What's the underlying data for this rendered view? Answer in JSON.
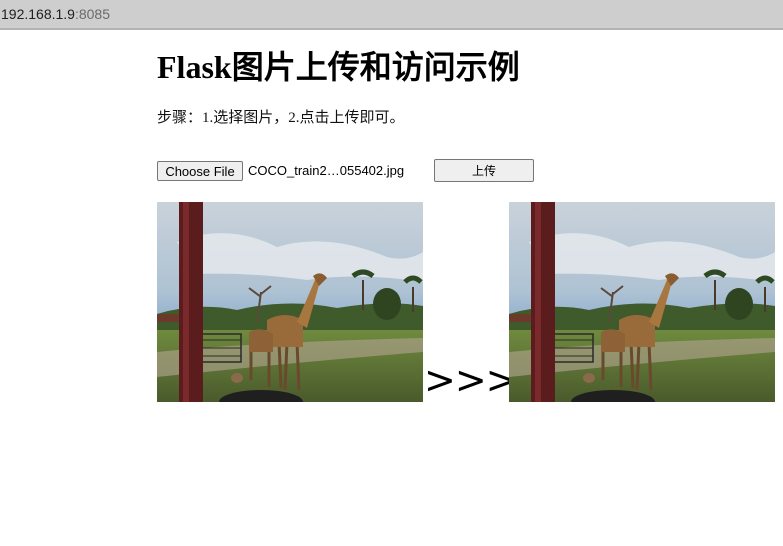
{
  "browser": {
    "address_host": "192.168.1.9",
    "address_port": ":8085"
  },
  "page": {
    "title": "Flask图片上传和访问示例",
    "steps": "步骤：1.选择图片，2.点击上传即可。",
    "choose_file_label": "Choose File",
    "selected_file": "COCO_train2…055402.jpg",
    "upload_label": "上传",
    "arrow_text": ">>>"
  },
  "images": {
    "input_alt": "giraffe-photo-input",
    "output_alt": "giraffe-photo-output"
  }
}
